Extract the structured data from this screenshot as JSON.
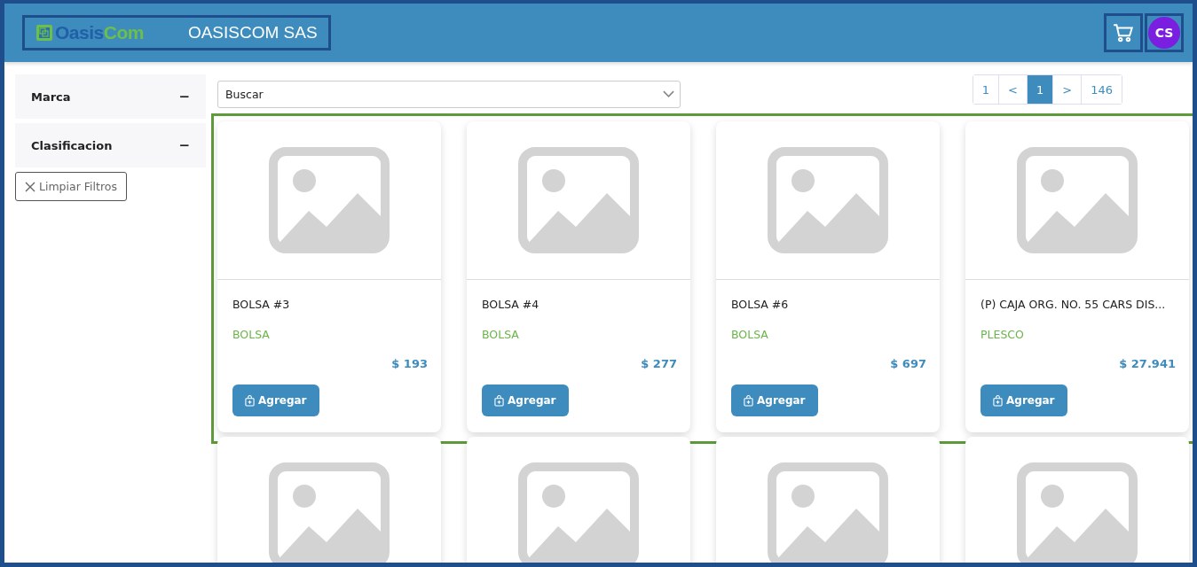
{
  "header": {
    "logo": {
      "first": "Oasis",
      "second": "Com"
    },
    "company": "OASISCOM SAS",
    "avatar": "CS"
  },
  "sidebar": {
    "filters": [
      {
        "label": "Marca",
        "expanded": true,
        "toggle": "−"
      },
      {
        "label": "Clasificacion",
        "expanded": true,
        "toggle": "−"
      }
    ],
    "clear_button": "Limpiar Filtros"
  },
  "search": {
    "placeholder": "Buscar"
  },
  "pagination": [
    {
      "label": "1",
      "selected": false
    },
    {
      "label": "<",
      "selected": false
    },
    {
      "label": "1",
      "selected": true
    },
    {
      "label": ">",
      "selected": false
    },
    {
      "label": "146",
      "selected": false
    }
  ],
  "products": [
    {
      "kind": "full",
      "name": "BOLSA #3",
      "brand": "BOLSA",
      "price": "$ 193",
      "button": "Agregar"
    },
    {
      "kind": "full",
      "name": "BOLSA #4",
      "brand": "BOLSA",
      "price": "$ 277",
      "button": "Agregar"
    },
    {
      "kind": "full",
      "name": "BOLSA #6",
      "brand": "BOLSA",
      "price": "$ 697",
      "button": "Agregar"
    },
    {
      "kind": "full",
      "name": "(P) CAJA ORG. NO. 55 CARS DIS...",
      "brand": "PLESCO",
      "price": "$ 27.941",
      "button": "Agregar"
    },
    {
      "kind": "image_only"
    },
    {
      "kind": "image_only"
    },
    {
      "kind": "image_only"
    },
    {
      "kind": "image_only"
    }
  ]
}
